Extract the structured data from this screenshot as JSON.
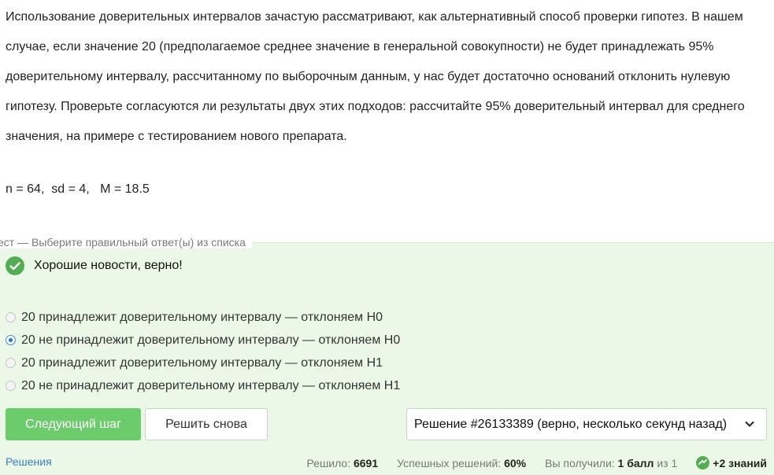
{
  "problem": {
    "text": "Использование доверительных интервалов зачастую рассматривают, как альтернативный способ проверки гипотез. В нашем случае, если значение 20 (предполагаемое среднее значение в генеральной совокупности) не будет принадлежать 95% доверительному интервалу, рассчитанному по выборочным данным, у нас будет достаточно оснований отклонить нулевую гипотезу. Проверьте согласуются ли результаты двух этих подходов: рассчитайте 95% доверительный интервал для среднего значения, на примере с тестированием нового препарата.",
    "given": "n = 64,  sd = 4,   M = 18.5"
  },
  "quiz": {
    "legend": "ест — Выберите правильный ответ(ы) из списка",
    "feedback": "Хорошие новости, верно!",
    "options": [
      {
        "label": "20 принадлежит доверительному интервалу — отклоняем H0",
        "checked": false
      },
      {
        "label": "20 не принадлежит доверительному интервалу — отклоняем H0",
        "checked": true
      },
      {
        "label": "20 принадлежит доверительному интервалу — отклоняем H1",
        "checked": false
      },
      {
        "label": "20 не принадлежит доверительному интервалу — отклоняем H1",
        "checked": false
      }
    ],
    "next_button": "Следующий шаг",
    "retry_button": "Решить снова",
    "solution_select": "Решение #26133389 (верно, несколько секунд назад)",
    "solutions_link": "Решения"
  },
  "stats": {
    "solved_label": "Решило:",
    "solved_value": "6691",
    "success_label": "Успешных решений:",
    "success_value": "60%",
    "got_label": "Вы получили:",
    "got_value": "1 балл",
    "got_suffix": "из 1",
    "knowledge": "+2 знаний"
  },
  "colors": {
    "accent_green": "#6ccc6b",
    "success_green": "#54ad54",
    "quiz_background": "#ebf8e8",
    "link_blue": "#3b7fc4"
  }
}
